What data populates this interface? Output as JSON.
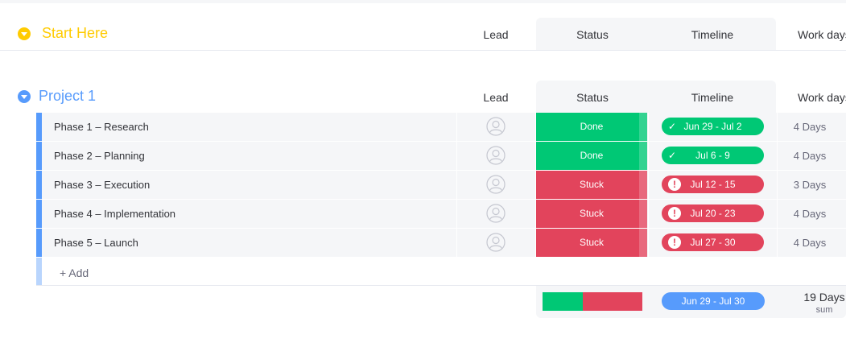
{
  "colors": {
    "start_here": "#ffcb00",
    "project": "#579bfc",
    "done": "#00c875",
    "done_fold": "#33d391",
    "stuck": "#e2445c",
    "stuck_fold": "#e8697d"
  },
  "groups": [
    {
      "title": "Start Here",
      "color": "#ffcb00",
      "columns": {
        "lead": "Lead",
        "status": "Status",
        "timeline": "Timeline",
        "work_days": "Work days"
      }
    },
    {
      "title": "Project 1",
      "color": "#579bfc",
      "columns": {
        "lead": "Lead",
        "status": "Status",
        "timeline": "Timeline",
        "work_days": "Work days"
      },
      "rows": [
        {
          "name": "Phase 1 – Research",
          "lead_icon": "person-icon",
          "status": "Done",
          "timeline": "Jun 29 - Jul 2",
          "timeline_icon": "check-icon",
          "work_days": "4 Days"
        },
        {
          "name": "Phase 2 – Planning",
          "lead_icon": "person-icon",
          "status": "Done",
          "timeline": "Jul 6 - 9",
          "timeline_icon": "check-icon",
          "work_days": "4 Days"
        },
        {
          "name": "Phase 3 – Execution",
          "lead_icon": "person-icon",
          "status": "Stuck",
          "timeline": "Jul 12 - 15",
          "timeline_icon": "alert-icon",
          "work_days": "3 Days"
        },
        {
          "name": "Phase 4 – Implementation",
          "lead_icon": "person-icon",
          "status": "Stuck",
          "timeline": "Jul 20 - 23",
          "timeline_icon": "alert-icon",
          "work_days": "4 Days"
        },
        {
          "name": "Phase 5 – Launch",
          "lead_icon": "person-icon",
          "status": "Stuck",
          "timeline": "Jul 27 - 30",
          "timeline_icon": "alert-icon",
          "work_days": "4 Days"
        }
      ],
      "add_label": "+ Add",
      "summary": {
        "status_distribution": {
          "done_fraction": 0.4,
          "stuck_fraction": 0.6
        },
        "timeline": "Jun 29 - Jul 30",
        "work_days_total": "19 Days",
        "work_days_label": "sum"
      }
    }
  ]
}
